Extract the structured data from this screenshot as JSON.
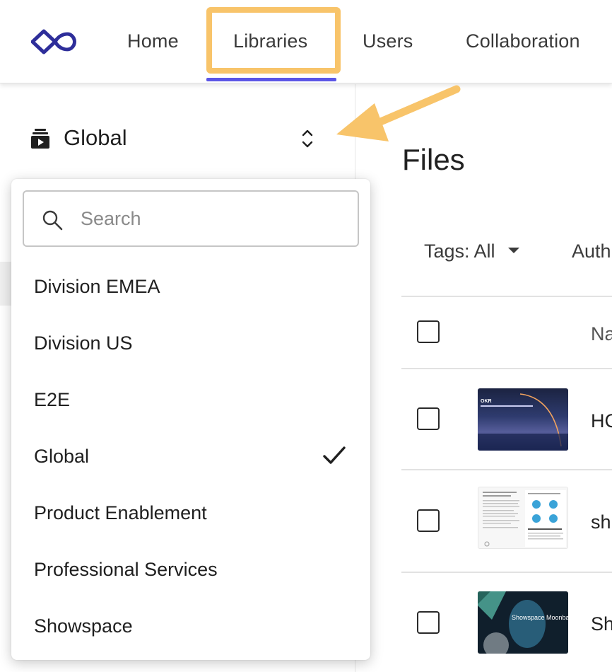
{
  "nav": {
    "items": [
      {
        "label": "Home"
      },
      {
        "label": "Libraries"
      },
      {
        "label": "Users"
      },
      {
        "label": "Collaboration"
      }
    ],
    "active": "Libraries",
    "accent_color": "#5b55e6",
    "highlight_color": "#f8c46a"
  },
  "sidebar": {
    "current_library": "Global",
    "library_icon": "library-icon",
    "toggle_icon": "chevron-up-down-icon"
  },
  "dropdown": {
    "search_placeholder": "Search",
    "options": [
      {
        "label": "Division EMEA",
        "selected": false
      },
      {
        "label": "Division US",
        "selected": false
      },
      {
        "label": "E2E",
        "selected": false
      },
      {
        "label": "Global",
        "selected": true
      },
      {
        "label": "Product Enablement",
        "selected": false
      },
      {
        "label": "Professional Services",
        "selected": false
      },
      {
        "label": "Showspace",
        "selected": false
      }
    ]
  },
  "main": {
    "title": "Files",
    "filters": {
      "tags_label": "Tags: All",
      "author_label": "Auth"
    },
    "table": {
      "name_header": "Na",
      "rows": [
        {
          "name": "HC",
          "thumb_text": "OKR"
        },
        {
          "name": "sh",
          "thumb_text": ""
        },
        {
          "name": "Sh",
          "thumb_text": "Showspace Moonbase"
        }
      ]
    }
  }
}
